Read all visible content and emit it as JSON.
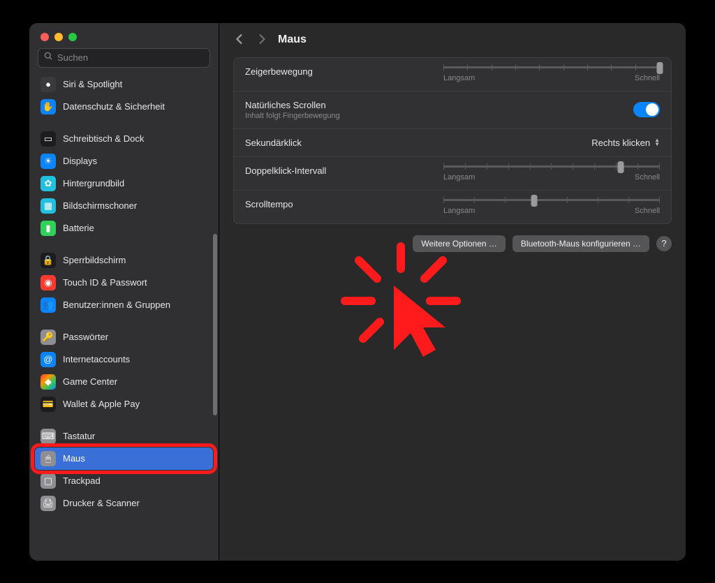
{
  "search": {
    "placeholder": "Suchen"
  },
  "sidebar": {
    "items": [
      {
        "label": "Siri & Spotlight",
        "bg": "#3a3a3c",
        "glyph": "●"
      },
      {
        "label": "Datenschutz & Sicherheit",
        "bg": "#0a84ff",
        "glyph": "✋"
      },
      {
        "gap": true
      },
      {
        "label": "Schreibtisch & Dock",
        "bg": "#1c1c1e",
        "glyph": "▭"
      },
      {
        "label": "Displays",
        "bg": "#0a84ff",
        "glyph": "☀"
      },
      {
        "label": "Hintergrundbild",
        "bg": "#22c0de",
        "glyph": "✿"
      },
      {
        "label": "Bildschirmschoner",
        "bg": "#22c0de",
        "glyph": "▦"
      },
      {
        "label": "Batterie",
        "bg": "#30d158",
        "glyph": "▮"
      },
      {
        "gap": true
      },
      {
        "label": "Sperrbildschirm",
        "bg": "#1c1c1e",
        "glyph": "🔒"
      },
      {
        "label": "Touch ID & Passwort",
        "bg": "#ff3b30",
        "glyph": "◉"
      },
      {
        "label": "Benutzer:innen & Gruppen",
        "bg": "#0a84ff",
        "glyph": "👥"
      },
      {
        "gap": true
      },
      {
        "label": "Passwörter",
        "bg": "#8e8e93",
        "glyph": "🔑"
      },
      {
        "label": "Internetaccounts",
        "bg": "#0a84ff",
        "glyph": "@"
      },
      {
        "label": "Game Center",
        "bg": "linear-gradient(135deg,#ff3b30,#ff9500,#34c759,#0a84ff)",
        "glyph": "◆"
      },
      {
        "label": "Wallet & Apple Pay",
        "bg": "#1c1c1e",
        "glyph": "💳"
      },
      {
        "gap": true
      },
      {
        "label": "Tastatur",
        "bg": "#8e8e93",
        "glyph": "⌨"
      },
      {
        "label": "Maus",
        "bg": "#8e8e93",
        "glyph": "🖱",
        "selected": true
      },
      {
        "label": "Trackpad",
        "bg": "#8e8e93",
        "glyph": "▢"
      },
      {
        "label": "Drucker & Scanner",
        "bg": "#8e8e93",
        "glyph": "🖨"
      }
    ]
  },
  "header": {
    "title": "Maus"
  },
  "settings": {
    "tracking": {
      "label": "Zeigerbewegung",
      "slow": "Langsam",
      "fast": "Schnell",
      "value_pct": 100
    },
    "natural_scroll": {
      "label": "Natürliches Scrollen",
      "sub": "Inhalt folgt Fingerbewegung",
      "on": true
    },
    "secondary_click": {
      "label": "Sekundärklick",
      "value": "Rechts klicken"
    },
    "double_click": {
      "label": "Doppelklick-Intervall",
      "slow": "Langsam",
      "fast": "Schnell",
      "value_pct": 82
    },
    "scroll_speed": {
      "label": "Scrolltempo",
      "slow": "Langsam",
      "fast": "Schnell",
      "value_pct": 42
    }
  },
  "footer": {
    "more_options": "Weitere Optionen …",
    "bluetooth_config": "Bluetooth-Maus konfigurieren …",
    "help": "?"
  }
}
